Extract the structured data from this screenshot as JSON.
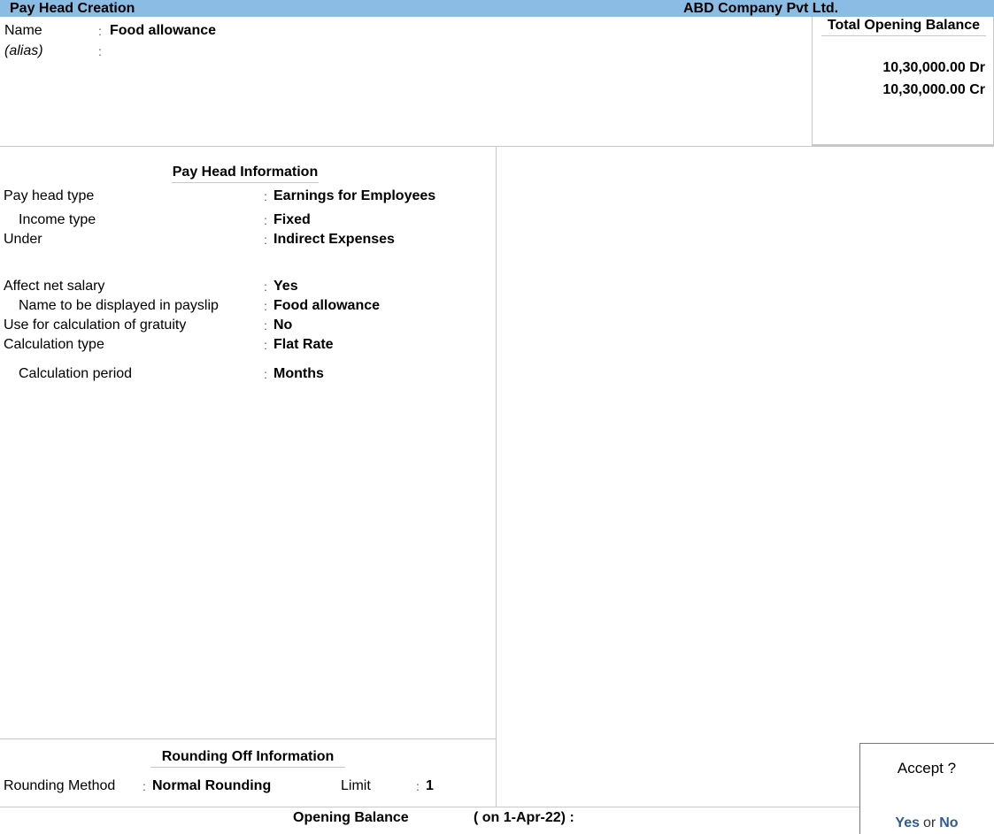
{
  "titlebar": {
    "title": "Pay Head  Creation",
    "company": "ABD Company Pvt Ltd."
  },
  "header": {
    "name_label": "Name",
    "name_value": "Food allowance",
    "alias_label": "(alias)",
    "alias_value": "",
    "colon": ":"
  },
  "total_opening_balance": {
    "title": "Total Opening Balance",
    "debit": "10,30,000.00 Dr",
    "credit": "10,30,000.00 Cr"
  },
  "pay_head_info": {
    "heading": "Pay Head Information",
    "fields": [
      {
        "label": "Pay head type",
        "value": "Earnings for Employees"
      },
      {
        "label": "Income type",
        "value": "Fixed"
      },
      {
        "label": "Under",
        "value": "Indirect Expenses"
      },
      {
        "label": "Affect net salary",
        "value": "Yes"
      },
      {
        "label": "Name to be displayed in payslip",
        "value": "Food allowance"
      },
      {
        "label": "Use for calculation of gratuity",
        "value": "No"
      },
      {
        "label": "Calculation type",
        "value": "Flat Rate"
      },
      {
        "label": "Calculation period",
        "value": "Months"
      }
    ]
  },
  "rounding_info": {
    "heading": "Rounding Off Information",
    "method_label": "Rounding Method",
    "method_value": "Normal Rounding",
    "limit_label": "Limit",
    "limit_value": "1"
  },
  "opening_balance": {
    "label": "Opening Balance",
    "date_text": "( on 1-Apr-22)  :",
    "value": ""
  },
  "accept_dialog": {
    "question": "Accept ?",
    "yes_label": "Yes",
    "or_label": "or",
    "no_label": "No"
  }
}
